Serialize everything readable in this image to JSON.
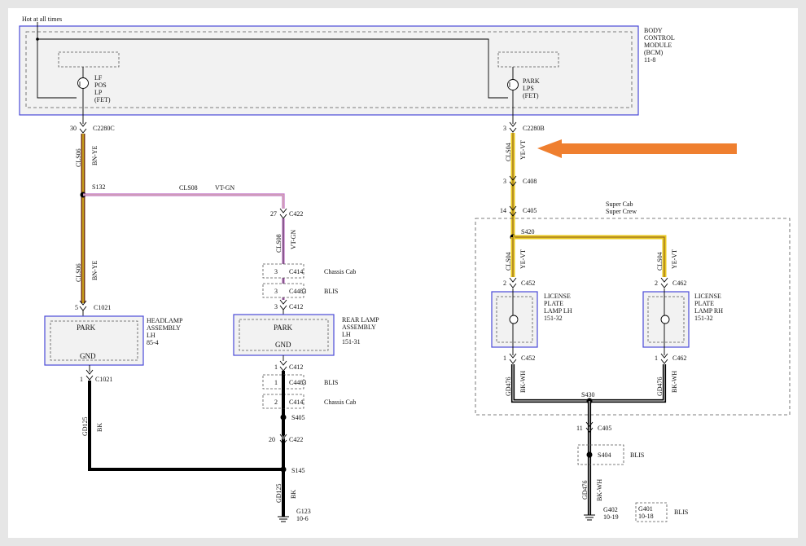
{
  "supply": {
    "label": "Hot at all times"
  },
  "bcm": {
    "line1": "BODY",
    "line2": "CONTROL",
    "line3": "MODULE",
    "line4": "(BCM)",
    "ref": "11-8"
  },
  "fet_left": {
    "l1": "LF",
    "l2": "POS",
    "l3": "LP",
    "l4": "(FET)"
  },
  "fet_right": {
    "l1": "PARK",
    "l2": "LPS",
    "l3": "(FET)"
  },
  "left_branch": {
    "pin_c2280c": "30",
    "c2280c": "C2280C",
    "circuit": "CLS06",
    "color": "BN-YE",
    "splice": "S132",
    "circuit2": "CLS06",
    "color2": "BN-YE",
    "pin_c1021": "5",
    "c1021": "C1021",
    "pin_c1021_out": "1",
    "c1021_out": "C1021",
    "gnd_circuit": "GD125",
    "gnd_color": "BK"
  },
  "headlamp": {
    "park": "PARK",
    "gnd": "GND",
    "l1": "HEADLAMP",
    "l2": "ASSEMBLY",
    "l3": "LH",
    "ref": "85-4"
  },
  "middle_branch": {
    "circuit_h": "CLS08",
    "color_h": "VT-GN",
    "pin_c422": "27",
    "c422": "C422",
    "circuit": "CLS08",
    "color": "VT-GN",
    "pin_c414": "3",
    "c414": "C414",
    "c414_note": "Chassis Cab",
    "pin_c4483": "3",
    "c4483": "C4483",
    "c4483_note": "BLIS",
    "pin_c412": "3",
    "c412": "C412",
    "pin_c412_out": "1",
    "c412_out": "C412",
    "pin_c4483_b": "1",
    "c4483_b": "C4483",
    "c4483_b_note": "BLIS",
    "pin_c414_b": "2",
    "c414_b": "C414",
    "c414_b_note": "Chassis Cab",
    "s405": "S405",
    "pin_c422_b": "20",
    "c422_b": "C422",
    "s145": "S145",
    "gnd_circuit": "GD125",
    "gnd_color": "BK",
    "ground": "G123",
    "ground_ref": "10-6"
  },
  "rear_lamp": {
    "park": "PARK",
    "gnd": "GND",
    "l1": "REAR LAMP",
    "l2": "ASSEMBLY",
    "l3": "LH",
    "ref": "151-31"
  },
  "right_branch": {
    "pin_c2280b": "3",
    "c2280b": "C2280B",
    "circuit": "CLS04",
    "color": "YE-VT",
    "pin_c408": "3",
    "c408": "C408",
    "pin_c405": "14",
    "c405": "C405",
    "region_l1": "Super Cab",
    "region_l2": "Super Crew",
    "s420": "S420",
    "circuit_a": "CLS04",
    "color_a": "YE-VT",
    "circuit_b": "CLS04",
    "color_b": "YE-VT",
    "pin_c452": "2",
    "c452": "C452",
    "pin_c462": "2",
    "c462": "C462",
    "pin_c452_out": "1",
    "c452_out": "C452",
    "pin_c462_out": "1",
    "c462_out": "C462",
    "gnd_a": "GD476",
    "gnd_a_color": "BK-WH",
    "gnd_b": "GD476",
    "gnd_b_color": "BK-WH",
    "s430": "S430",
    "pin_c405_b": "11",
    "c405_b": "C405",
    "s404": "S404",
    "s404_note": "BLIS",
    "gnd_circuit": "GD476",
    "gnd_color": "BK-WH",
    "g402": "G402",
    "g402_ref": "10-19",
    "g401": "G401",
    "g401_ref": "10-18",
    "g401_note": "BLIS"
  },
  "lp_lh": {
    "l1": "LICENSE",
    "l2": "PLATE",
    "l3": "LAMP LH",
    "ref": "151-32"
  },
  "lp_rh": {
    "l1": "LICENSE",
    "l2": "PLATE",
    "l3": "LAMP RH",
    "ref": "151-32"
  },
  "colors": {
    "brown_yellow": "#7a3a12",
    "yellow": "#e8c81e",
    "violet": "#c070c8",
    "highlight_arrow": "#ef7f2f",
    "module_blue": "#4a4ad8"
  }
}
